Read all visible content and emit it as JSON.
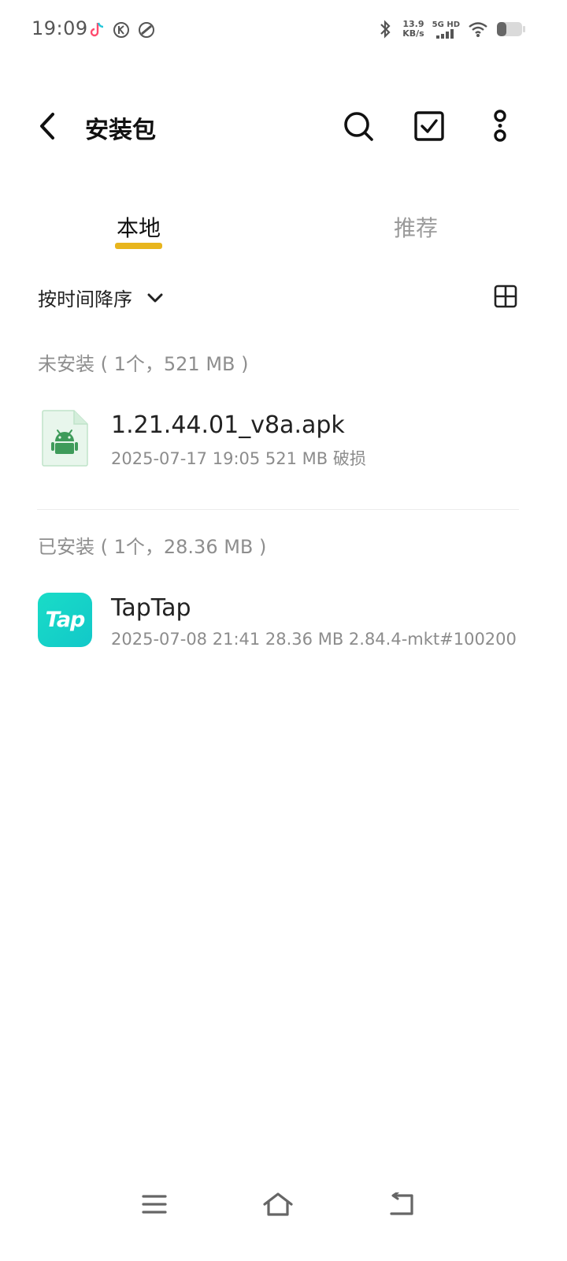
{
  "status_bar": {
    "time": "19:09",
    "net_speed_value": "13.9",
    "net_speed_unit": "KB/s",
    "signal_label": "5G HD"
  },
  "header": {
    "title": "安装包"
  },
  "tabs": {
    "local": "本地",
    "recommend": "推荐",
    "accent_color": "#e8b51d"
  },
  "sort": {
    "label": "按时间降序"
  },
  "sections": {
    "not_installed": {
      "title": "未安装 ( 1个，521 MB )",
      "items": [
        {
          "name": "1.21.44.01_v8a.apk",
          "meta": "2025-07-17 19:05  521 MB  破损",
          "icon": "android-apk-icon"
        }
      ]
    },
    "installed": {
      "title": "已安装 ( 1个，28.36 MB )",
      "items": [
        {
          "name": "TapTap",
          "meta": "2025-07-08 21:41  28.36 MB  2.84.4-mkt#100200",
          "icon_text": "Tap",
          "icon_color": "#16d4c6"
        }
      ]
    }
  }
}
